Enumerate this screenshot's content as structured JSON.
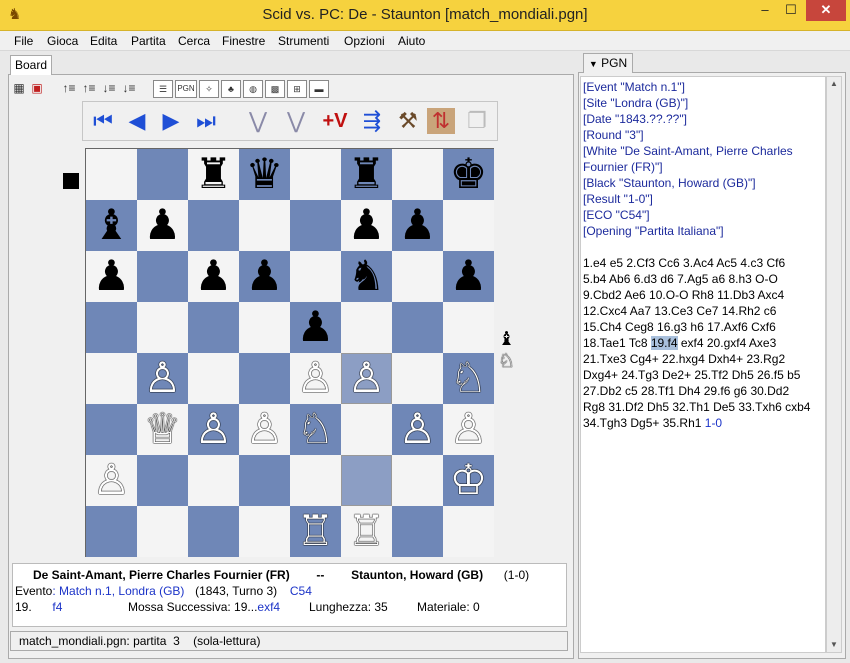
{
  "window": {
    "title": "Scid vs. PC: De - Staunton [match_mondiali.pgn]",
    "minimize": "–",
    "maximize": "☐",
    "close": "✕"
  },
  "menu": [
    "File",
    "Gioca",
    "Edita",
    "Partita",
    "Cerca",
    "Finestre",
    "Strumenti",
    "Opzioni",
    "Aiuto"
  ],
  "board_tab": "Board",
  "pgn_tab": "PGN",
  "toolbar": {
    "pgn_label": "PGN"
  },
  "nav": {
    "first": "⏮",
    "back": "◀",
    "forward": "▶",
    "last": "⏭",
    "var_back": "⋁",
    "var_fwd": "⋁",
    "add_var": "+V"
  },
  "board": {
    "ranks": [
      [
        "",
        "",
        "♜",
        "♛",
        "",
        "♜",
        "",
        "♚"
      ],
      [
        "♝",
        "♟",
        "",
        "",
        "",
        "♟",
        "♟",
        ""
      ],
      [
        "♟",
        "",
        "♟",
        "♟",
        "",
        "♞",
        "",
        "♟"
      ],
      [
        "",
        "",
        "",
        "",
        "♟",
        "",
        "",
        ""
      ],
      [
        "",
        "♙",
        "",
        "",
        "♙",
        "♙",
        "",
        "♘"
      ],
      [
        "",
        "♕",
        "♙",
        "♙",
        "♘",
        "",
        "♙",
        "♙"
      ],
      [
        "♙",
        "",
        "",
        "",
        "",
        "",
        "",
        "♔"
      ],
      [
        "",
        "",
        "",
        "",
        "♖",
        "♖",
        "",
        ""
      ]
    ],
    "highlight": [
      "f4",
      "f2"
    ]
  },
  "captured": {
    "black": "♝",
    "white": "♘"
  },
  "info": {
    "white_player": "De Saint-Amant, Pierre Charles Fournier (FR)",
    "sep": "--",
    "black_player": "Staunton, Howard (GB)",
    "result": "(1-0)",
    "event_label": "Evento",
    "event_value": ": Match n.1, Londra (GB)",
    "event_extra": "(1843, Turno 3)",
    "eco": "C54",
    "move_no": "19.",
    "last_move": "f4",
    "next_label": "Mossa Successiva:",
    "next_prefix": "19...",
    "next_move": "exf4",
    "length_label": "Lunghezza: 35",
    "material_label": "Materiale: 0"
  },
  "status": "match_mondiali.pgn: partita  3    (sola-lettura)",
  "pgn": {
    "headers": [
      "[Event \"Match n.1\"]",
      "[Site \"Londra (GB)\"]",
      "[Date \"1843.??.??\"]",
      "[Round \"3\"]",
      "[White \"De Saint-Amant, Pierre Charles",
      "Fournier (FR)\"]",
      "[Black \"Staunton, Howard (GB)\"]",
      "[Result \"1-0\"]",
      "[ECO \"C54\"]",
      "[Opening \"Partita Italiana\"]"
    ],
    "moves_before": [
      "1.e4 e5 2.Cf3 Cc6 3.Ac4 Ac5 4.c3 Cf6",
      "5.b4 Ab6 6.d3 d6 7.Ag5 a6 8.h3 O-O",
      "9.Cbd2 Ae6 10.O-O Rh8 11.Db3 Axc4",
      "12.Cxc4 Aa7 13.Ce3 Ce7 14.Rh2 c6",
      "15.Ch4 Ceg8 16.g3 h6 17.Axf6 Cxf6"
    ],
    "line_pre": "18.Tae1 Tc8 ",
    "current_move": "19.f4",
    "line_post": " exf4 20.gxf4 Axe3",
    "moves_after": [
      "21.Txe3 Cg4+ 22.hxg4 Dxh4+ 23.Rg2",
      "Dxg4+ 24.Tg3 De2+ 25.Tf2 Dh5 26.f5 b5",
      "27.Db2 c5 28.Tf1 Dh4 29.f6 g6 30.Dd2",
      "Rg8 31.Df2 Dh5 32.Th1 De5 33.Txh6 cxb4"
    ],
    "last_line_pre": "34.Tgh3 Dg5+ 35.Rh1 ",
    "result": "1-0"
  }
}
